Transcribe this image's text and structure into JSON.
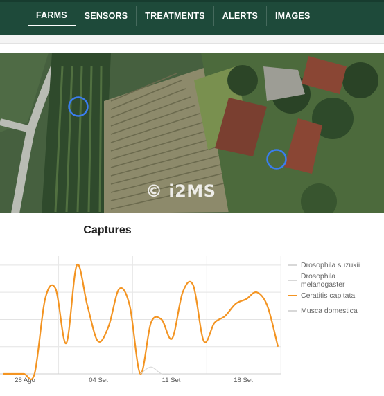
{
  "nav": {
    "items": [
      {
        "label": "FARMS",
        "active": true
      },
      {
        "label": "SENSORS",
        "active": false
      },
      {
        "label": "TREATMENTS",
        "active": false
      },
      {
        "label": "ALERTS",
        "active": false
      },
      {
        "label": "IMAGES",
        "active": false
      }
    ]
  },
  "map": {
    "watermark": "© i2MS",
    "trap_markers": 2,
    "marker_color": "#3a7df0"
  },
  "colors": {
    "topbar": "#1e4a3a",
    "series_active": "#f39422",
    "series_inactive": "#d8d8d8"
  },
  "chart_data": {
    "type": "line",
    "title": "Captures",
    "xlabel": "",
    "ylabel": "",
    "x_ticks": [
      "28 Ago",
      "04 Set",
      "11 Set",
      "18 Set"
    ],
    "grid": true,
    "legend_position": "right",
    "series": [
      {
        "name": "Drosophila suzukii",
        "visible": false,
        "x": [],
        "values": []
      },
      {
        "name": "Drosophila melanogaster",
        "visible": false,
        "x": [],
        "values": []
      },
      {
        "name": "Ceratitis capitata",
        "visible": true,
        "x": [
          "26 Ago",
          "27 Ago",
          "28 Ago",
          "29 Ago",
          "30 Ago",
          "31 Ago",
          "01 Set",
          "02 Set",
          "03 Set",
          "04 Set",
          "05 Set",
          "06 Set",
          "07 Set",
          "08 Set",
          "09 Set",
          "10 Set",
          "11 Set",
          "12 Set",
          "13 Set",
          "14 Set",
          "15 Set",
          "16 Set",
          "17 Set",
          "18 Set",
          "19 Set",
          "20 Set",
          "21 Set"
        ],
        "values": [
          0,
          0,
          0,
          0,
          11,
          12.5,
          4.5,
          16,
          10,
          4.8,
          7,
          12.5,
          10,
          0,
          7.5,
          8,
          5.2,
          12,
          13,
          4.8,
          7.5,
          8.5,
          10.3,
          11,
          12,
          10,
          4
        ]
      },
      {
        "name": "Musca domestica",
        "visible": false,
        "x": [
          "08 Set",
          "09 Set",
          "10 Set",
          "11 Set"
        ],
        "values": [
          0,
          1,
          0,
          0
        ]
      }
    ]
  }
}
